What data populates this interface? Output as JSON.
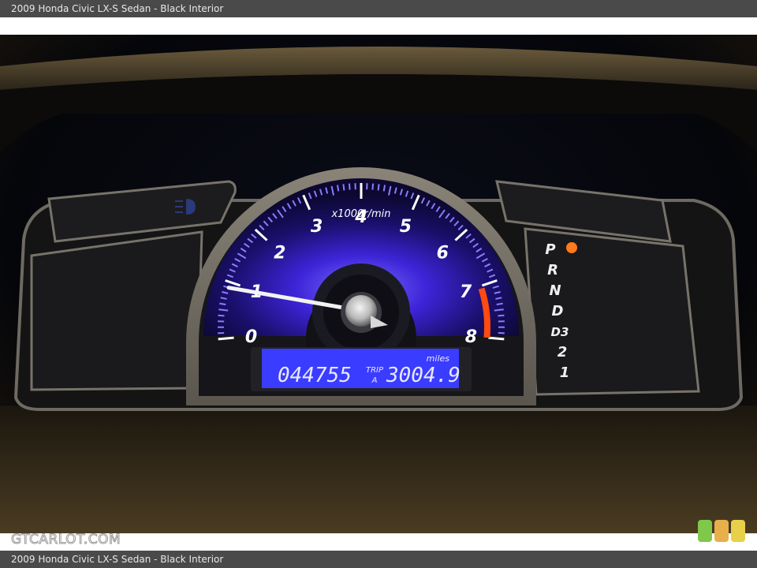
{
  "header": {
    "caption": "2009 Honda Civic LX-S Sedan - Black Interior"
  },
  "footer": {
    "caption": "2009 Honda Civic LX-S Sedan - Black Interior"
  },
  "watermark": {
    "text": "GTCARLOT.COM"
  },
  "tachometer": {
    "ticks": [
      "0",
      "1",
      "2",
      "3",
      "4",
      "5",
      "6",
      "7",
      "8"
    ],
    "unit": "x1000r/min",
    "reading": 0.9
  },
  "odometer": {
    "total": "044755",
    "trip_label_top": "TRIP",
    "trip_label_bottom": "A",
    "trip": "3004.9",
    "unit": "miles"
  },
  "gear_indicator": {
    "positions": [
      "P",
      "R",
      "N",
      "D",
      "D3",
      "2",
      "1"
    ],
    "selected": "P"
  },
  "colors": {
    "gauge_glow": "#4a2cff",
    "redline": "#ff4a10",
    "lcd_bg": "#3a3cff",
    "indicator": "#ff7a1a"
  }
}
